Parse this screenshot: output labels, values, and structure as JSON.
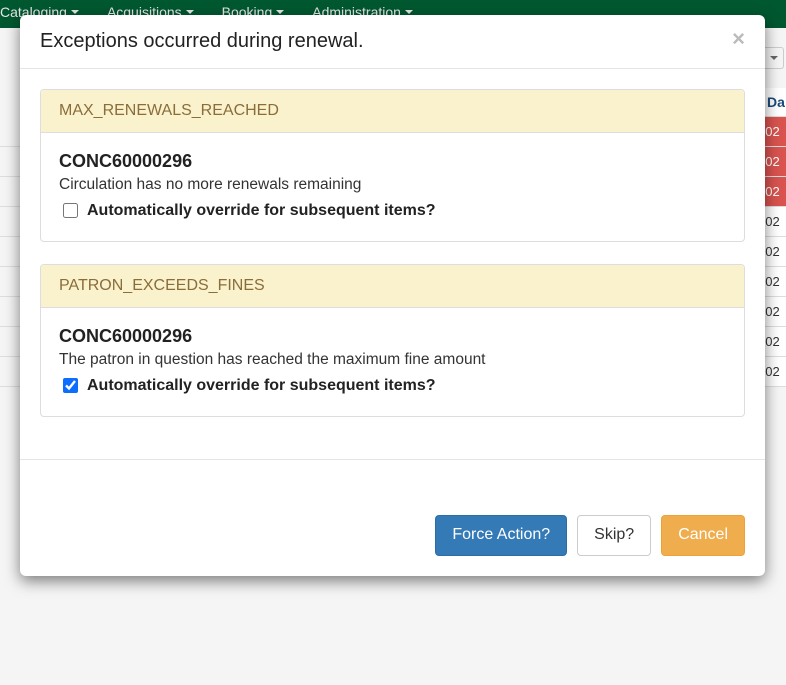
{
  "nav": {
    "items": [
      "Cataloging",
      "Acquisitions",
      "Booking",
      "Administration"
    ]
  },
  "bg": {
    "col_header": "Da",
    "red_cells": [
      "02",
      "02",
      "02"
    ],
    "white_cells": [
      "02",
      "02",
      "02",
      "02",
      "02",
      "02"
    ]
  },
  "modal": {
    "title": "Exceptions occurred during renewal.",
    "close_x": "×"
  },
  "exceptions": [
    {
      "code": "MAX_RENEWALS_REACHED",
      "barcode": "CONC60000296",
      "reason": "Circulation has no more renewals remaining",
      "override_label": "Automatically override for subsequent items?",
      "override_checked": false
    },
    {
      "code": "PATRON_EXCEEDS_FINES",
      "barcode": "CONC60000296",
      "reason": "The patron in question has reached the maximum fine amount",
      "override_label": "Automatically override for subsequent items?",
      "override_checked": true
    }
  ],
  "footer": {
    "force": "Force Action?",
    "skip": "Skip?",
    "cancel": "Cancel"
  }
}
